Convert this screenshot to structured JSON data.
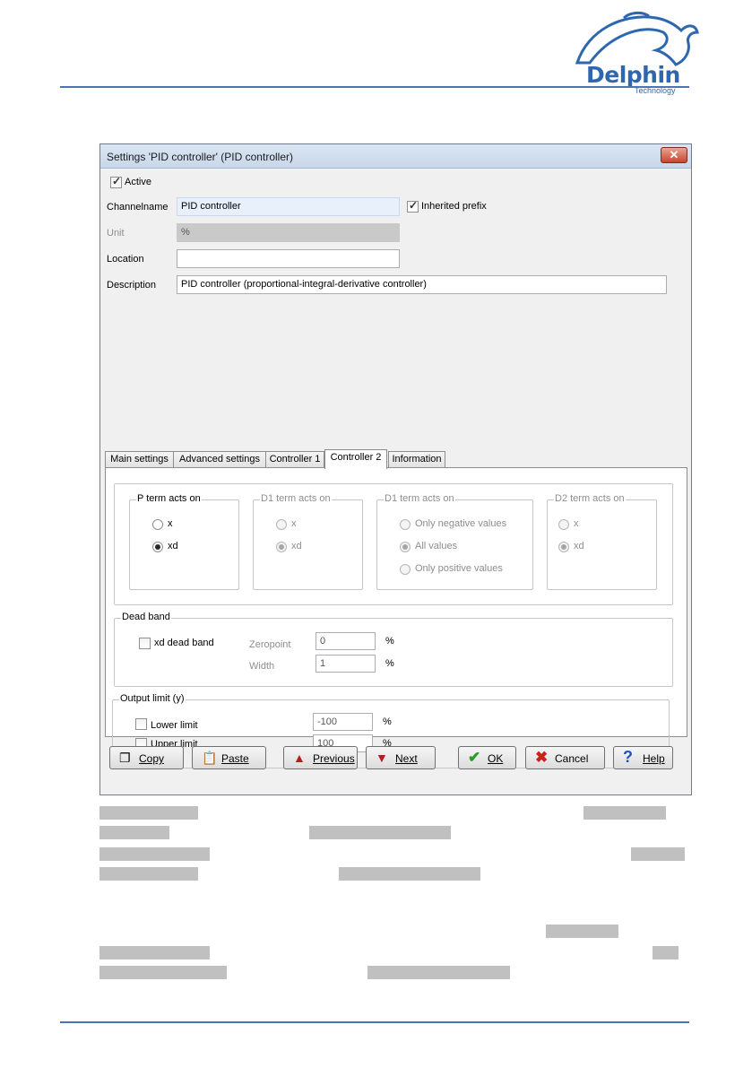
{
  "dialog": {
    "title": "Settings 'PID controller' (PID controller)",
    "close_glyph": "✕"
  },
  "logo": {
    "word": "Delphin",
    "sub": "Technology"
  },
  "form": {
    "active_label": "Active",
    "active_checked": true,
    "channelname_label": "Channelname",
    "channelname_value": "PID controller",
    "inherited_prefix_label": "Inherited prefix",
    "inherited_prefix_checked": true,
    "unit_label": "Unit",
    "unit_value": "%",
    "location_label": "Location",
    "location_value": "",
    "description_label": "Description",
    "description_value": "PID controller (proportional-integral-derivative controller)"
  },
  "tabs": [
    "Main settings",
    "Advanced settings",
    "Controller 1",
    "Controller 2",
    "Information"
  ],
  "active_tab": "Controller 2",
  "term_groups": [
    {
      "title": "P term acts on",
      "enabled": true,
      "options": [
        "x",
        "xd"
      ],
      "selected": "xd"
    },
    {
      "title": "D1 term acts on",
      "enabled": false,
      "options": [
        "x",
        "xd"
      ],
      "selected": "xd"
    },
    {
      "title": "D1 term acts on",
      "enabled": false,
      "options": [
        "Only negative values",
        "All values",
        "Only positive values"
      ],
      "selected": "All values"
    },
    {
      "title": "D2 term acts on",
      "enabled": false,
      "options": [
        "x",
        "xd"
      ],
      "selected": "xd"
    }
  ],
  "dead_band": {
    "title": "Dead band",
    "checkbox_label": "xd dead band",
    "checked": false,
    "zeropoint_label": "Zeropoint",
    "zeropoint_value": "0",
    "width_label": "Width",
    "width_value": "1",
    "unit": "%"
  },
  "output_limit": {
    "title": "Output limit (y)",
    "lower_label": "Lower limit",
    "lower_checked": false,
    "lower_value": "-100",
    "upper_label": "Upper limit",
    "upper_checked": false,
    "upper_value": "100",
    "unit": "%"
  },
  "buttons": [
    {
      "label": "Copy",
      "icon": "copy-icon"
    },
    {
      "label": "Paste",
      "icon": "paste-icon"
    },
    {
      "label": "Previous",
      "icon": "arrow-up-icon"
    },
    {
      "label": "Next",
      "icon": "arrow-down-icon"
    },
    {
      "label": "OK",
      "icon": "checkmark-icon"
    },
    {
      "label": "Cancel",
      "icon": "cross-icon"
    },
    {
      "label": "Help",
      "icon": "help-icon"
    }
  ],
  "colors": {
    "accent_rule": "#4a74b4",
    "logo_blue": "#2f67ae",
    "ok_green": "#2e9a2e",
    "cancel_red": "#c8241b",
    "arrow_red": "#b41d1d",
    "help_blue": "#2453b8"
  }
}
